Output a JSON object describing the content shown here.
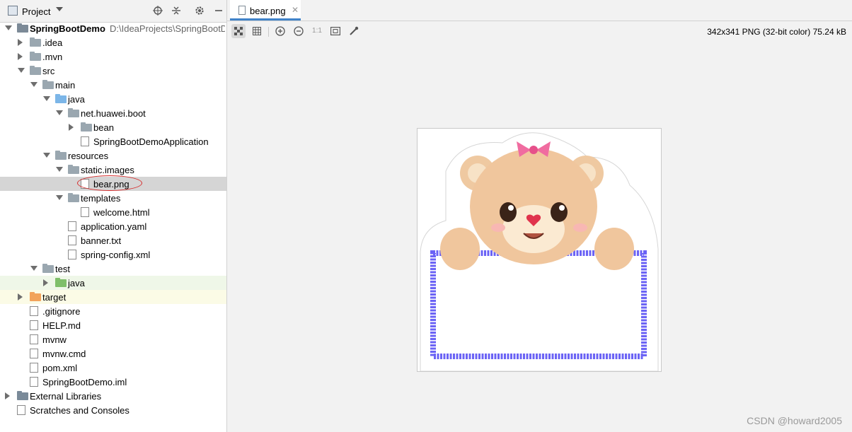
{
  "project_panel": {
    "title": "Project",
    "tree": [
      {
        "label": "SpringBootDemo",
        "path": "D:\\IdeaProjects\\SpringBootD",
        "level": 0,
        "state": "down",
        "icon": "module-folder-icon",
        "bold": true
      },
      {
        "label": ".idea",
        "level": 1,
        "state": "right",
        "icon": "folder-icon"
      },
      {
        "label": ".mvn",
        "level": 1,
        "state": "right",
        "icon": "folder-icon"
      },
      {
        "label": "src",
        "level": 1,
        "state": "down",
        "icon": "folder-icon"
      },
      {
        "label": "main",
        "level": 2,
        "state": "down",
        "icon": "folder-icon"
      },
      {
        "label": "java",
        "level": 3,
        "state": "down",
        "icon": "source-folder-icon"
      },
      {
        "label": "net.huawei.boot",
        "level": 4,
        "state": "down",
        "icon": "package-icon"
      },
      {
        "label": "bean",
        "level": 5,
        "state": "right",
        "icon": "package-icon"
      },
      {
        "label": "SpringBootDemoApplication",
        "level": 5,
        "state": "none",
        "icon": "spring-class-icon"
      },
      {
        "label": "resources",
        "level": 3,
        "state": "down",
        "icon": "resources-folder-icon"
      },
      {
        "label": "static.images",
        "level": 4,
        "state": "down",
        "icon": "folder-icon"
      },
      {
        "label": "bear.png",
        "level": 5,
        "state": "none",
        "icon": "image-file-icon",
        "selected": true,
        "circled": true
      },
      {
        "label": "templates",
        "level": 4,
        "state": "down",
        "icon": "folder-icon"
      },
      {
        "label": "welcome.html",
        "level": 5,
        "state": "none",
        "icon": "html-file-icon"
      },
      {
        "label": "application.yaml",
        "level": 4,
        "state": "none",
        "icon": "yaml-file-icon"
      },
      {
        "label": "banner.txt",
        "level": 4,
        "state": "none",
        "icon": "text-file-icon"
      },
      {
        "label": "spring-config.xml",
        "level": 4,
        "state": "none",
        "icon": "xml-file-icon"
      },
      {
        "label": "test",
        "level": 2,
        "state": "down",
        "icon": "folder-icon"
      },
      {
        "label": "java",
        "level": 3,
        "state": "right",
        "icon": "test-folder-icon",
        "highlight": "green"
      },
      {
        "label": "target",
        "level": 1,
        "state": "right",
        "icon": "excluded-folder-icon",
        "highlight": "yellow"
      },
      {
        "label": ".gitignore",
        "level": 1,
        "state": "none",
        "icon": "gitignore-file-icon"
      },
      {
        "label": "HELP.md",
        "level": 1,
        "state": "none",
        "icon": "markdown-file-icon"
      },
      {
        "label": "mvnw",
        "level": 1,
        "state": "none",
        "icon": "text-file-icon"
      },
      {
        "label": "mvnw.cmd",
        "level": 1,
        "state": "none",
        "icon": "text-file-icon"
      },
      {
        "label": "pom.xml",
        "level": 1,
        "state": "none",
        "icon": "maven-file-icon"
      },
      {
        "label": "SpringBootDemo.iml",
        "level": 1,
        "state": "none",
        "icon": "iml-file-icon"
      },
      {
        "label": "External Libraries",
        "level": 0,
        "state": "right",
        "icon": "libraries-icon"
      },
      {
        "label": "Scratches and Consoles",
        "level": 0,
        "state": "none",
        "icon": "scratches-icon"
      }
    ]
  },
  "editor": {
    "tab_label": "bear.png",
    "image_info": "342x341 PNG (32-bit color) 75.24 kB",
    "zoom_label": "1:1"
  },
  "colors": {
    "selection": "#d5d5d5",
    "accent": "#4083c9",
    "frame": "#6b63f5"
  },
  "watermark": "CSDN @howard2005"
}
